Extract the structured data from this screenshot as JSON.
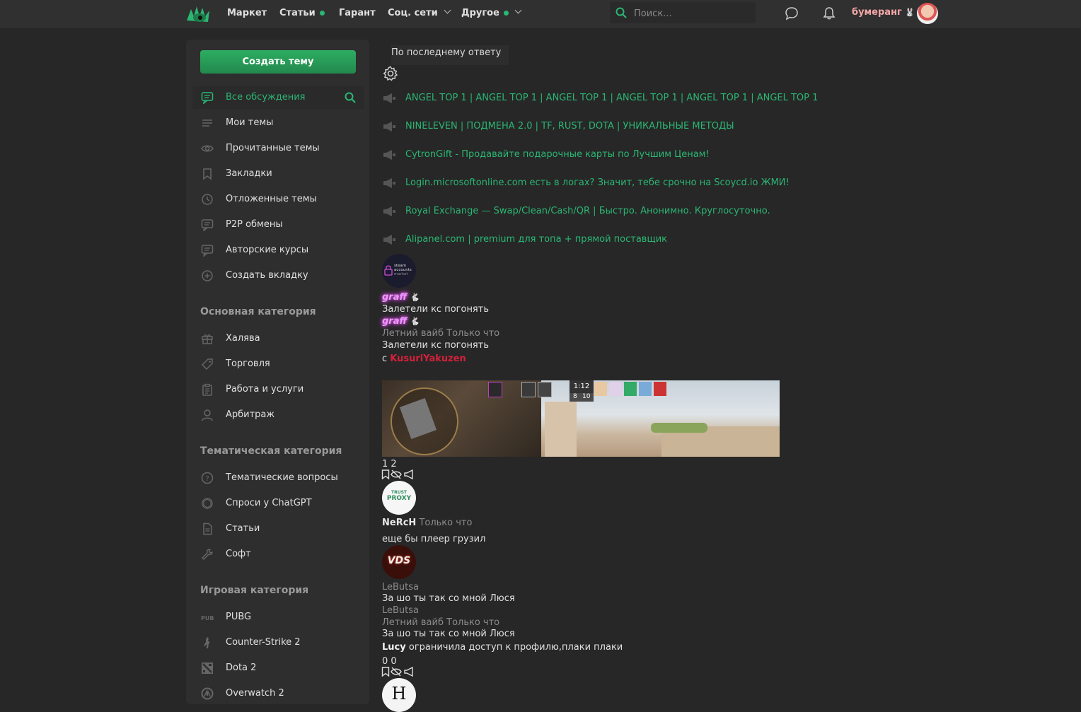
{
  "colors": {
    "accent": "#2bb673",
    "bg": "#272727",
    "panel": "#2e2e2e",
    "topbar": "#303030"
  },
  "nav": {
    "items": [
      {
        "label": "Маркет",
        "dot": false,
        "chevron": false
      },
      {
        "label": "Статьи",
        "dot": true,
        "chevron": false
      },
      {
        "label": "Гарант",
        "dot": false,
        "chevron": false
      },
      {
        "label": "Соц. сети",
        "dot": false,
        "chevron": true
      },
      {
        "label": "Другое",
        "dot": true,
        "chevron": true
      }
    ],
    "search_placeholder": "Поиск...",
    "username": "бумеранг"
  },
  "sidebar": {
    "create_label": "Создать тему",
    "items": [
      {
        "label": "Все обсуждения",
        "icon": "chat-icon",
        "active": true
      },
      {
        "label": "Мои темы",
        "icon": "list-icon"
      },
      {
        "label": "Прочитанные темы",
        "icon": "eye-icon"
      },
      {
        "label": "Закладки",
        "icon": "bookmark-icon"
      },
      {
        "label": "Отложенные темы",
        "icon": "clock-icon"
      },
      {
        "label": "P2P обмены",
        "icon": "chat-icon"
      },
      {
        "label": "Авторские курсы",
        "icon": "chat-icon"
      },
      {
        "label": "Создать вкладку",
        "icon": "plus-circle-icon"
      }
    ],
    "categories": [
      {
        "title": "Основная категория",
        "items": [
          {
            "label": "Халява",
            "icon": "gift-icon"
          },
          {
            "label": "Торговля",
            "icon": "tag-icon"
          },
          {
            "label": "Работа и услуги",
            "icon": "clipboard-icon"
          },
          {
            "label": "Арбитраж",
            "icon": "user-icon"
          }
        ]
      },
      {
        "title": "Тематическая категория",
        "items": [
          {
            "label": "Тематические вопросы",
            "icon": "question-icon"
          },
          {
            "label": "Спроси у ChatGPT",
            "icon": "openai-icon"
          },
          {
            "label": "Статьи",
            "icon": "document-icon"
          },
          {
            "label": "Софт",
            "icon": "wrench-icon"
          }
        ]
      },
      {
        "title": "Игровая категория",
        "items": [
          {
            "label": "PUBG",
            "icon": "pubg-icon"
          },
          {
            "label": "Counter-Strike 2",
            "icon": "cs-icon"
          },
          {
            "label": "Dota 2",
            "icon": "dota-icon"
          },
          {
            "label": "Overwatch 2",
            "icon": "overwatch-icon"
          }
        ]
      }
    ]
  },
  "main": {
    "sort_label": "По последнему ответу",
    "sticky_threads": [
      "ANGEL TOP 1 | ANGEL TOP 1 | ANGEL TOP 1 | ANGEL TOP 1 | ANGEL TOP 1 | ANGEL TOP 1",
      "NINELEVEN | ПОДМЕНА 2.0 | TF, RUST, DOTA | УНИКАЛЬНЫЕ МЕТОДЫ",
      "CytronGift - Продавайте подарочные карты по Лучшим Ценам!",
      "Login.microsoftonline.com есть в логах? Значит, тебе срочно на Scoycd.io ЖМИ!",
      "Royal Exchange — Swap/Clean/Cash/QR | Быстро. Анонимно. Круглосуточно.",
      "Alipanel.com | premium для топа + прямой поставщик"
    ],
    "threads": [
      {
        "avatar_text1": "steam",
        "avatar_text2": "accounts",
        "avatar_text3": "market",
        "author": "graff",
        "title": "Залетели кс погонять",
        "author2": "graff",
        "category": "Летний вайб",
        "time": "Только что",
        "title2": "Залетели кс погонять",
        "with_prefix": "с",
        "with_user": "KusuriYakuzen",
        "banner_timer": "1:12",
        "banner_score_left": "8",
        "banner_score_right": "10",
        "counts": "1 2"
      },
      {
        "avatar_text1": "TRUST",
        "avatar_text2": "PROXY",
        "author": "NeRcH",
        "time": "Только что",
        "title": "еще бы плеер грузил"
      },
      {
        "avatar_text1": "VDS",
        "author": "LeButsa",
        "title": "За шо ты так со мной Люся",
        "author2": "LeButsa",
        "category": "Летний вайб",
        "time": "Только что",
        "title2": "За шо ты так со мной Люся",
        "last_user": "Lucy",
        "last_text": "ограничила доступ к профилю,плаки плаки",
        "counts": "0 0"
      },
      {
        "avatar_text1": "H"
      }
    ]
  }
}
